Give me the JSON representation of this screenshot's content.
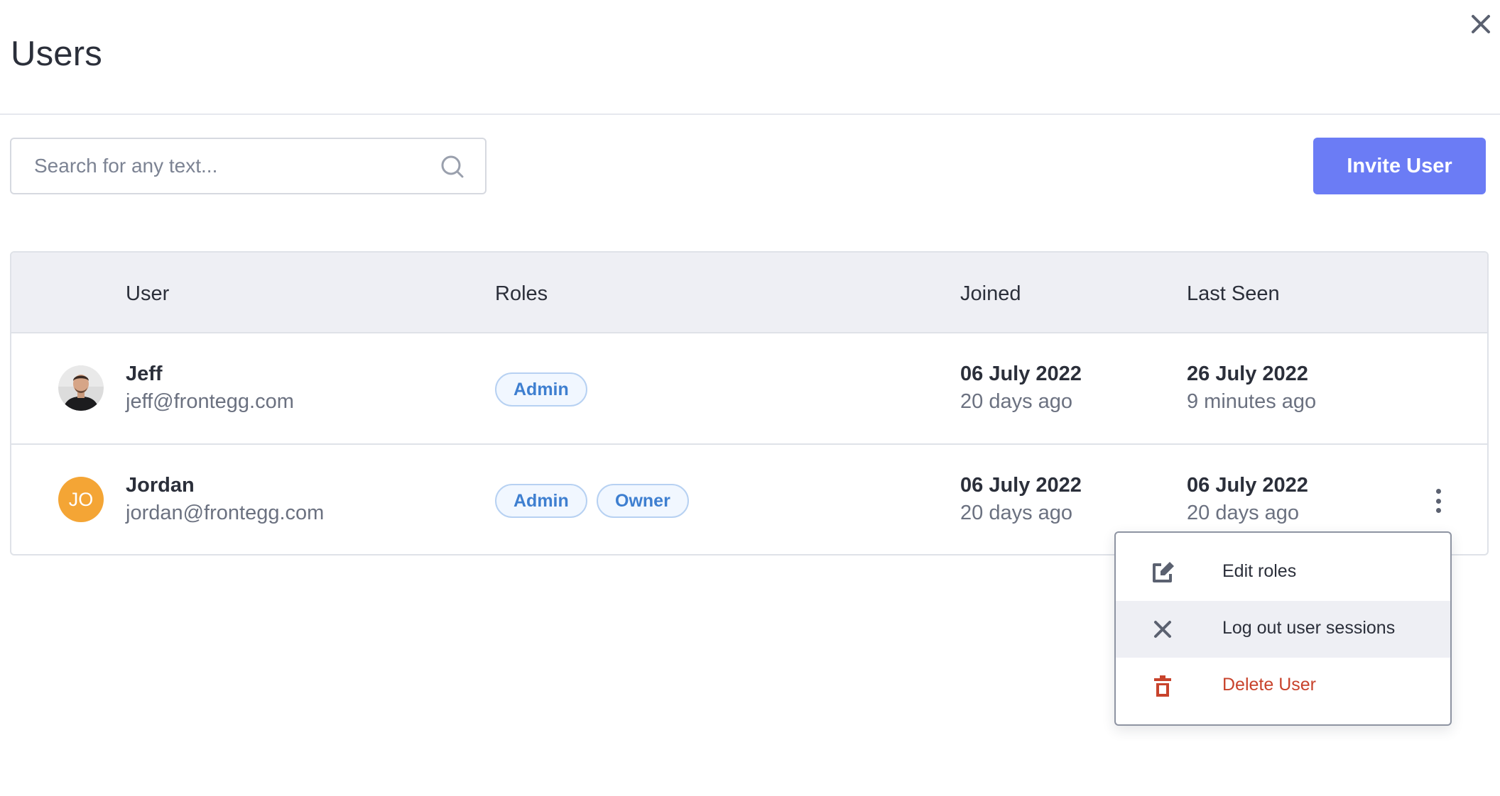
{
  "page": {
    "title": "Users"
  },
  "search": {
    "placeholder": "Search for any text...",
    "value": ""
  },
  "toolbar": {
    "invite_label": "Invite User",
    "invite_color": "#6b7cf5"
  },
  "table": {
    "columns": {
      "user": "User",
      "roles": "Roles",
      "joined": "Joined",
      "last_seen": "Last Seen"
    },
    "rows": [
      {
        "name": "Jeff",
        "email": "jeff@frontegg.com",
        "avatar": "photo",
        "roles": [
          "Admin"
        ],
        "joined_date": "06 July 2022",
        "joined_relative": "20 days ago",
        "last_seen_date": "26 July 2022",
        "last_seen_relative": "9 minutes ago"
      },
      {
        "name": "Jordan",
        "email": "jordan@frontegg.com",
        "avatar": "JO",
        "avatar_color": "#f4a535",
        "roles": [
          "Admin",
          "Owner"
        ],
        "joined_date": "06 July 2022",
        "joined_relative": "20 days ago",
        "last_seen_date": "06 July 2022",
        "last_seen_relative": "20 days ago"
      }
    ]
  },
  "row_menu": {
    "items": [
      {
        "label": "Edit roles",
        "icon": "edit-icon"
      },
      {
        "label": "Log out user sessions",
        "icon": "close-x-icon"
      },
      {
        "label": "Delete User",
        "icon": "trash-icon",
        "color": "#c8432c"
      }
    ]
  },
  "icons": {
    "close": "close-icon",
    "search": "search-icon",
    "more": "kebab-icon"
  }
}
